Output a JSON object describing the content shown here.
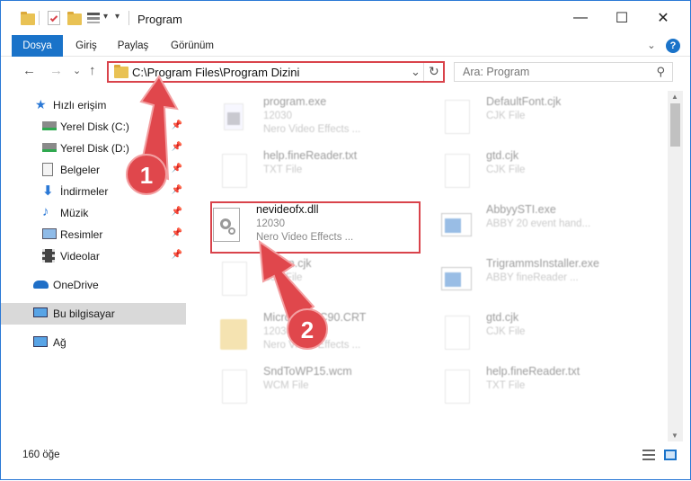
{
  "window": {
    "title": "Program"
  },
  "controls": {
    "minimize": "—",
    "maximize": "☐",
    "close": "✕"
  },
  "ribbon": {
    "tabs": [
      "Dosya",
      "Giriş",
      "Paylaş",
      "Görünüm"
    ],
    "expand": "⌄",
    "help": "?"
  },
  "nav": {
    "back": "←",
    "forward": "→",
    "recent": "⌄",
    "up": "↑"
  },
  "address": {
    "path": "C:\\Program Files\\Program Dizini",
    "dropdown": "⌄",
    "refresh": "↻"
  },
  "search": {
    "placeholder": "Ara: Program",
    "icon": "⚲"
  },
  "sidebar": {
    "items": [
      {
        "label": "Hızlı erişim",
        "icon": "star-icon"
      },
      {
        "label": "Yerel Disk (C:)",
        "icon": "drive-icon"
      },
      {
        "label": "Yerel Disk (D:)",
        "icon": "drive-icon"
      },
      {
        "label": "Belgeler",
        "icon": "documents-icon"
      },
      {
        "label": "İndirmeler",
        "icon": "download-icon"
      },
      {
        "label": "Müzik",
        "icon": "music-icon"
      },
      {
        "label": "Resimler",
        "icon": "pictures-icon"
      },
      {
        "label": "Videolar",
        "icon": "videos-icon"
      },
      {
        "label": "OneDrive",
        "icon": "cloud-icon"
      },
      {
        "label": "Bu bilgisayar",
        "icon": "computer-icon"
      },
      {
        "label": "Ağ",
        "icon": "network-icon"
      }
    ],
    "pin": "📌"
  },
  "files": [
    {
      "name": "program.exe",
      "line1": "12030",
      "line2": "Nero Video Effects ...",
      "icon": "exe-icon"
    },
    {
      "name": "DefaultFont.cjk",
      "line1": "CJK File",
      "line2": "",
      "icon": "file-icon"
    },
    {
      "name": "help.fineReader.txt",
      "line1": "TXT File",
      "line2": "",
      "icon": "file-icon"
    },
    {
      "name": "gtd.cjk",
      "line1": "CJK File",
      "line2": "",
      "icon": "file-icon"
    },
    {
      "name": "nevideofx.dll",
      "line1": "12030",
      "line2": "Nero Video Effects ...",
      "icon": "dll-icon"
    },
    {
      "name": "AbbyySTI.exe",
      "line1": "ABBY 20 event hand...",
      "line2": "",
      "icon": "app-icon"
    },
    {
      "name": "dbgen.cjk",
      "line1": "CJK File",
      "line2": "",
      "icon": "file-icon"
    },
    {
      "name": "TrigrammsInstaller.exe",
      "line1": "ABBY fineReader ...",
      "line2": "",
      "icon": "app-icon"
    },
    {
      "name": "Microsoft.VC90.CRT",
      "line1": "12030",
      "line2": "Nero Video Effects ...",
      "icon": "folder-icon"
    },
    {
      "name": "gtd.cjk",
      "line1": "CJK File",
      "line2": "",
      "icon": "file-icon"
    },
    {
      "name": "SndToWP15.wcm",
      "line1": "WCM File",
      "line2": "",
      "icon": "file-icon"
    },
    {
      "name": "help.fineReader.txt",
      "line1": "TXT File",
      "line2": "",
      "icon": "file-icon"
    }
  ],
  "status": {
    "count": "160 öğe"
  },
  "annotations": {
    "step1": "1",
    "step2": "2"
  },
  "colors": {
    "accent": "#1a73c9",
    "highlight": "#d9434b"
  }
}
